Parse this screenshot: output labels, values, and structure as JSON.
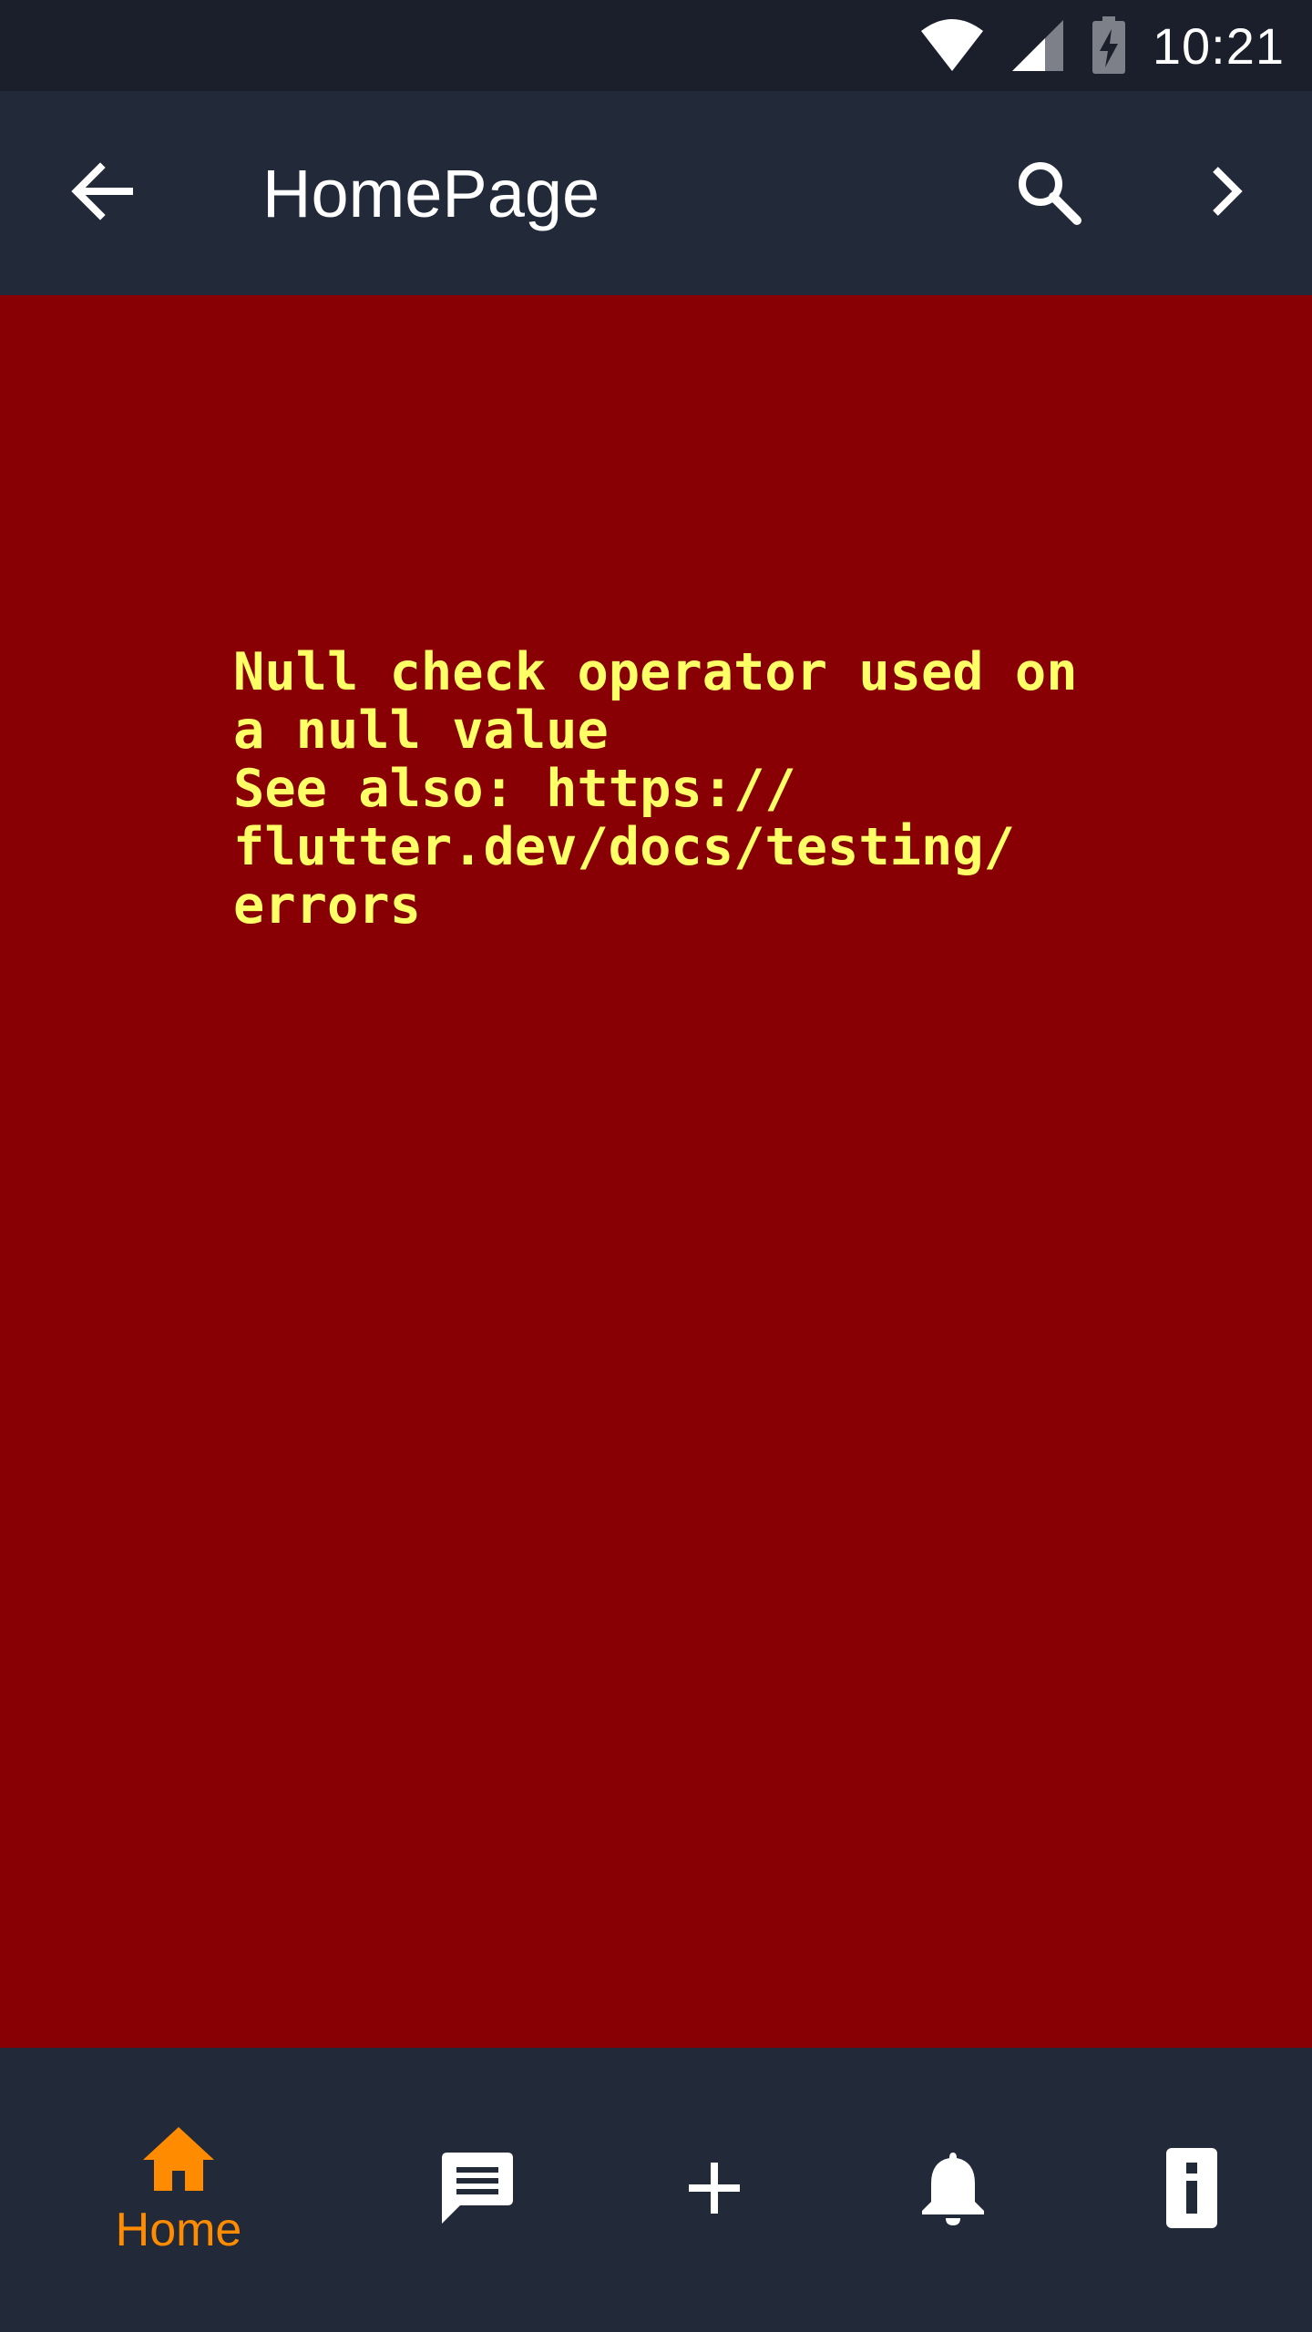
{
  "status_bar": {
    "time": "10:21",
    "icons": [
      "wifi-icon",
      "cell-signal-icon",
      "battery-charging-icon"
    ]
  },
  "app_bar": {
    "title": "HomePage",
    "icons": [
      "back-arrow-icon",
      "search-icon",
      "chevron-right-icon"
    ]
  },
  "error": {
    "message": "Null check operator used on\na null value\nSee also: https://\nflutter.dev/docs/testing/\nerrors",
    "background_color": "#880003",
    "text_color": "#ffff66"
  },
  "bottom_nav": {
    "items": [
      {
        "label": "Home",
        "icon": "home-icon",
        "active": true
      },
      {
        "label": "",
        "icon": "chat-icon",
        "active": false
      },
      {
        "label": "",
        "icon": "plus-icon",
        "active": false
      },
      {
        "label": "",
        "icon": "bell-icon",
        "active": false
      },
      {
        "label": "",
        "icon": "info-icon",
        "active": false
      }
    ],
    "active_color": "#ff8c00",
    "inactive_color": "#ffffff"
  }
}
